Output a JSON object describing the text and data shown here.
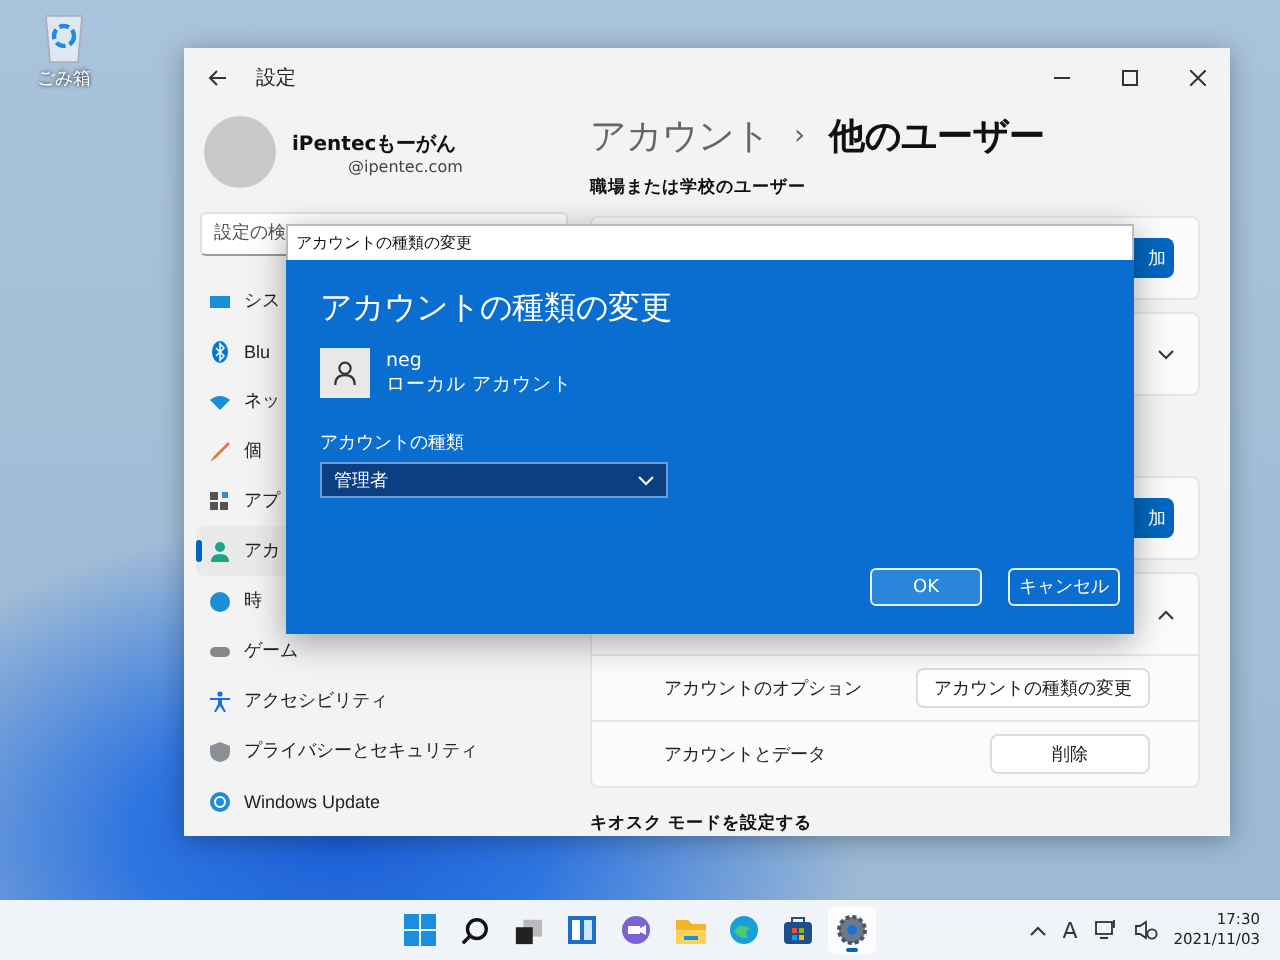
{
  "desktop_icons": [
    {
      "label": "ごみ箱"
    }
  ],
  "settings": {
    "title": "設定",
    "profile": {
      "name": "iPentecもーがん",
      "email": "@ipentec.com"
    },
    "search": {
      "placeholder": "設定の検"
    },
    "nav": [
      {
        "label": "シス",
        "selected": false
      },
      {
        "label": "Blu",
        "selected": false
      },
      {
        "label": "ネッ",
        "selected": false
      },
      {
        "label": "個",
        "selected": false
      },
      {
        "label": "アプ",
        "selected": false
      },
      {
        "label": "アカ",
        "selected": true
      },
      {
        "label": "時",
        "selected": false
      },
      {
        "label": "ゲーム",
        "selected": false
      },
      {
        "label": "アクセシビリティ",
        "selected": false
      },
      {
        "label": "プライバシーとセキュリティ",
        "selected": false
      },
      {
        "label": "Windows Update",
        "selected": false
      }
    ],
    "breadcrumb": {
      "parent": "アカウント",
      "separator": "›",
      "current": "他のユーザー"
    },
    "section_label": "職場または学校のユーザー",
    "cards": [
      {
        "kind": "button",
        "button": "加"
      },
      {
        "kind": "collapsed"
      },
      {
        "kind": "button",
        "button": "加"
      },
      {
        "kind": "expanded",
        "rows": [
          {
            "label": "アカウントのオプション",
            "button": "アカウントの種類の変更"
          },
          {
            "label": "アカウントとデータ",
            "button": "削除"
          }
        ]
      }
    ],
    "footer_label": "キオスク モードを設定する"
  },
  "dialog": {
    "title": "アカウントの種類の変更",
    "heading": "アカウントの種類の変更",
    "user": {
      "name": "neg",
      "type": "ローカル アカウント"
    },
    "field_label": "アカウントの種類",
    "select_value": "管理者",
    "buttons": [
      {
        "label": "OK",
        "kind": "primary"
      },
      {
        "label": "キャンセル",
        "kind": "secondary"
      }
    ]
  },
  "taskbar": {
    "apps": [
      {
        "kind": "start",
        "active": false
      },
      {
        "kind": "search",
        "active": false
      },
      {
        "kind": "taskview",
        "active": false
      },
      {
        "kind": "widgets",
        "active": false
      },
      {
        "kind": "chat",
        "active": false
      },
      {
        "kind": "explorer",
        "active": false
      },
      {
        "kind": "edge",
        "active": false
      },
      {
        "kind": "store",
        "active": false
      },
      {
        "kind": "settings",
        "active": true
      }
    ],
    "ime": "A",
    "clock": {
      "time": "17:30",
      "date": "2021/11/03"
    }
  }
}
